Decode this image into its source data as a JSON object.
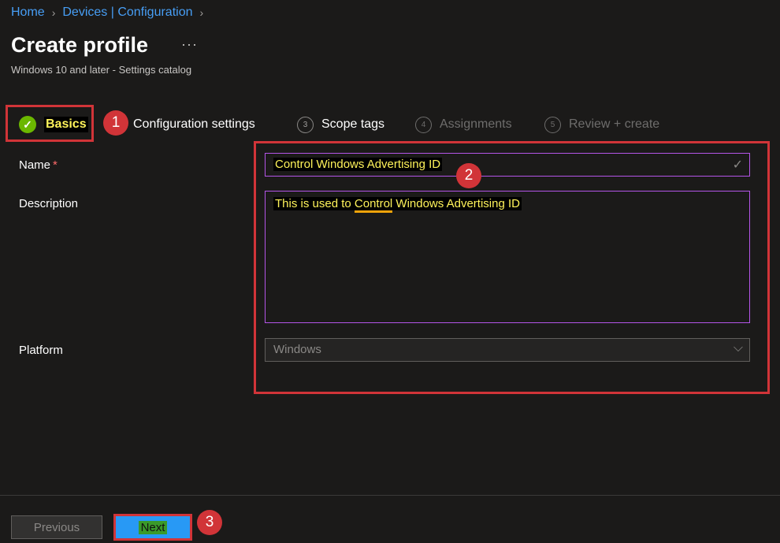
{
  "breadcrumb": {
    "home": "Home",
    "devices": "Devices | Configuration"
  },
  "page": {
    "title": "Create profile",
    "more": "···",
    "subtitle": "Windows 10 and later - Settings catalog"
  },
  "steps": [
    {
      "label": "Basics",
      "state": "done"
    },
    {
      "label": "Configuration settings",
      "state": "active"
    },
    {
      "number": "3",
      "label": "Scope tags",
      "state": "pending"
    },
    {
      "number": "4",
      "label": "Assignments",
      "state": "disabled"
    },
    {
      "number": "5",
      "label": "Review + create",
      "state": "disabled"
    }
  ],
  "annotations": [
    "1",
    "2",
    "3"
  ],
  "form": {
    "name_label": "Name",
    "required_mark": "*",
    "name_value": "Control Windows Advertising ID",
    "description_label": "Description",
    "description_prefix": "This is used to ",
    "description_underlined": "Control",
    "description_suffix": " Windows Advertising ID",
    "platform_label": "Platform",
    "platform_value": "Windows"
  },
  "footer": {
    "previous_label": "Previous",
    "next_label": "Next"
  },
  "colors": {
    "accent_blue": "#479ef5",
    "highlight_red": "#d13438",
    "success_green": "#6bb700",
    "focus_purple": "#b455e8"
  },
  "icons": {
    "check": "check-icon",
    "chevron": "chevron-down-icon",
    "breadcrumb_separator": "chevron-right-icon"
  }
}
